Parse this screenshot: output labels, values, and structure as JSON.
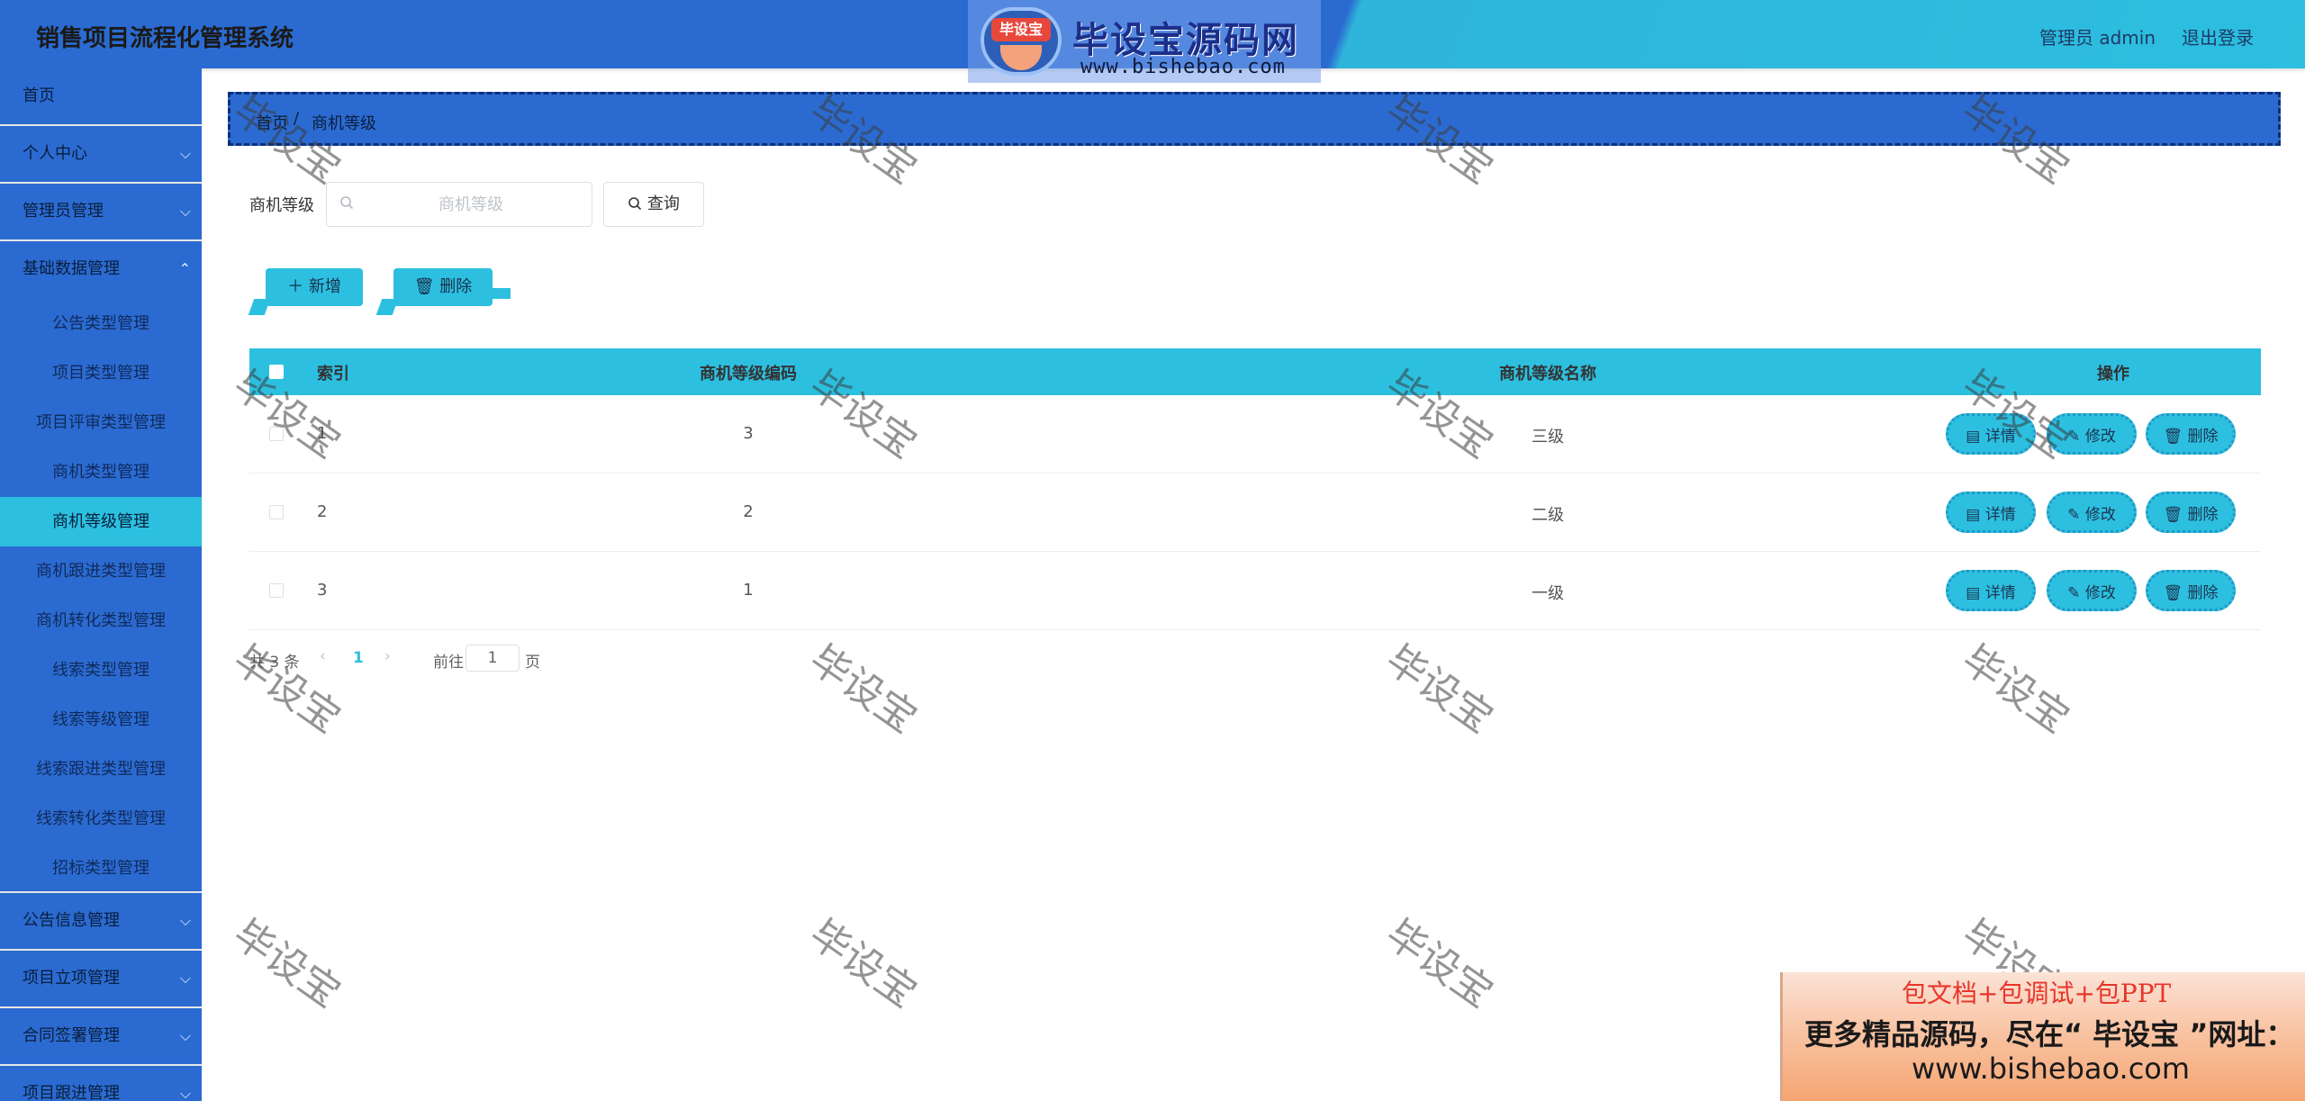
{
  "header": {
    "app_title": "销售项目流程化管理系统",
    "logo_badge": "毕设宝",
    "logo_text": "毕设宝源码网",
    "logo_url": "www.bishebao.com",
    "admin_label": "管理员 admin",
    "logout_label": "退出登录"
  },
  "sidebar": {
    "items": [
      {
        "label": "首页"
      },
      {
        "label": "个人中心"
      },
      {
        "label": "管理员管理"
      },
      {
        "label": "基础数据管理"
      }
    ],
    "submenu": [
      {
        "label": "公告类型管理"
      },
      {
        "label": "项目类型管理"
      },
      {
        "label": "项目评审类型管理"
      },
      {
        "label": "商机类型管理"
      },
      {
        "label": "商机等级管理"
      },
      {
        "label": "商机跟进类型管理"
      },
      {
        "label": "商机转化类型管理"
      },
      {
        "label": "线索类型管理"
      },
      {
        "label": "线索等级管理"
      },
      {
        "label": "线索跟进类型管理"
      },
      {
        "label": "线索转化类型管理"
      },
      {
        "label": "招标类型管理"
      }
    ],
    "items_after": [
      {
        "label": "公告信息管理"
      },
      {
        "label": "项目立项管理"
      },
      {
        "label": "合同签署管理"
      },
      {
        "label": "项目跟进管理"
      }
    ],
    "active_submenu": "商机等级管理"
  },
  "breadcrumb": {
    "home": "首页",
    "separator": "/",
    "current": "商机等级"
  },
  "search": {
    "label": "商机等级",
    "placeholder": "商机等级",
    "query_label": "查询"
  },
  "toolbar": {
    "add_label": "新增",
    "delete_label": "删除"
  },
  "table": {
    "columns": [
      "索引",
      "商机等级编码",
      "商机等级名称",
      "操作"
    ],
    "rows": [
      {
        "index": "1",
        "code": "3",
        "name": "三级"
      },
      {
        "index": "2",
        "code": "2",
        "name": "二级"
      },
      {
        "index": "3",
        "code": "1",
        "name": "一级"
      }
    ],
    "actions": {
      "detail": "详情",
      "edit": "修改",
      "delete": "删除"
    }
  },
  "pagination": {
    "total_text": "共 3 条",
    "current_page": "1",
    "goto_label": "前往",
    "goto_value": "1",
    "page_unit": "页"
  },
  "watermark_text": "毕设宝",
  "ad": {
    "line1": "包文档+包调试+包PPT",
    "line2": "更多精品源码，尽在“ 毕设宝 ”网址：",
    "line3": "www.bishebao.com"
  },
  "colors": {
    "primary_blue": "#2b6bd1",
    "accent_cyan": "#2cbfe0"
  }
}
